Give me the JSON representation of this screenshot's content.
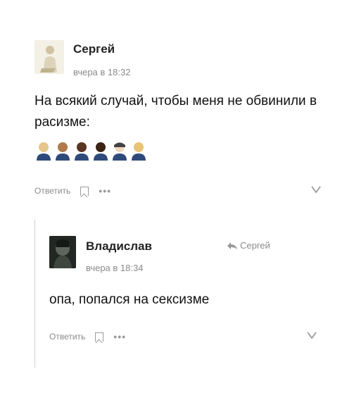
{
  "comment": {
    "author": "Сергей",
    "time": "вчера в 18:32",
    "text_line1": "На всякий случай, чтобы меня не обвинили в",
    "text_line2": "расизме:",
    "emoji_skin_tones": [
      "#e6c68b",
      "#b07a4a",
      "#5a3522",
      "#3b2416",
      "#f0d9bf",
      "#e8c373"
    ],
    "reply_label": "Ответить",
    "more_label": "•••"
  },
  "reply": {
    "author": "Владислав",
    "reply_to": "Сергей",
    "time": "вчера в 18:34",
    "text": "опа, попался на сексизме",
    "reply_label": "Ответить",
    "more_label": "•••"
  }
}
